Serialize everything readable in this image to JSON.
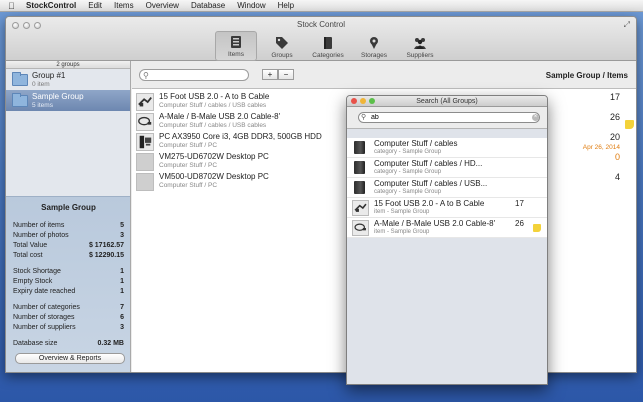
{
  "menubar": {
    "apple": "",
    "app": "StockControl",
    "items": [
      "Edit",
      "Items",
      "Overview",
      "Database",
      "Window",
      "Help"
    ]
  },
  "window": {
    "title": "Stock Control",
    "fullscreen": "⤢"
  },
  "toolbar": [
    {
      "label": "Items",
      "icon": "items-icon",
      "active": true
    },
    {
      "label": "Groups",
      "icon": "tag-icon",
      "active": false
    },
    {
      "label": "Categories",
      "icon": "book-icon",
      "active": false
    },
    {
      "label": "Storages",
      "icon": "pin-icon",
      "active": false
    },
    {
      "label": "Suppliers",
      "icon": "people-icon",
      "active": false
    }
  ],
  "sidebar": {
    "header": "2 groups",
    "groups": [
      {
        "name": "Group #1",
        "sub": "0 item"
      },
      {
        "name": "Sample Group",
        "sub": "5 items"
      }
    ]
  },
  "summary": {
    "title": "Sample Group",
    "rows1": [
      {
        "label": "Number of items",
        "value": "5"
      },
      {
        "label": "Number of photos",
        "value": "3"
      },
      {
        "label": "Total Value",
        "value": "$ 17162.57"
      },
      {
        "label": "Total cost",
        "value": "$ 12290.15"
      }
    ],
    "rows2": [
      {
        "label": "Stock Shortage",
        "value": "1"
      },
      {
        "label": "Empty Stock",
        "value": "1"
      },
      {
        "label": "Expiry date reached",
        "value": "1"
      }
    ],
    "rows3": [
      {
        "label": "Number of categories",
        "value": "7"
      },
      {
        "label": "Number of storages",
        "value": "6"
      },
      {
        "label": "Number of suppliers",
        "value": "3"
      }
    ],
    "rows4": [
      {
        "label": "Database size",
        "value": "0.32 MB"
      }
    ],
    "button": "Overview & Reports"
  },
  "list": {
    "search_placeholder": "",
    "add": "+",
    "remove": "−",
    "breadcrumb": "Sample Group / Items",
    "items": [
      {
        "name": "15 Foot USB 2.0 - A to B Cable",
        "path": "Computer Stuff / cables / USB cables",
        "qty": "17"
      },
      {
        "name": "A-Male / B-Male USB 2.0 Cable-8'",
        "path": "Computer Stuff / cables / USB cables",
        "qty": "26"
      },
      {
        "name": "PC AX3950 Core i3, 4GB DDR3, 500GB HDD",
        "path": "Computer Stuff / PC",
        "qty": "20",
        "date": "Apr 26, 2014"
      },
      {
        "name": "VM275-UD6702W Desktop PC",
        "path": "Computer Stuff / PC",
        "qty": "0"
      },
      {
        "name": "VM500-UD8702W Desktop PC",
        "path": "Computer Stuff / PC",
        "qty": "4"
      }
    ]
  },
  "search_window": {
    "title": "Search (All Groups)",
    "query": "ab",
    "results": [
      {
        "name": "Computer Stuff / cables",
        "sub": "category - Sample Group",
        "qty": ""
      },
      {
        "name": "Computer Stuff / cables / HD...",
        "sub": "category - Sample Group",
        "qty": ""
      },
      {
        "name": "Computer Stuff / cables / USB...",
        "sub": "category - Sample Group",
        "qty": ""
      },
      {
        "name": "15 Foot USB 2.0 - A to B Cable",
        "sub": "item - Sample Group",
        "qty": "17"
      },
      {
        "name": "A-Male / B-Male USB 2.0 Cable-8'",
        "sub": "item - Sample Group",
        "qty": "26"
      }
    ]
  },
  "colors": {
    "warning": "#e07d10",
    "selection": "#6d87b0",
    "note": "#f3d23a"
  }
}
